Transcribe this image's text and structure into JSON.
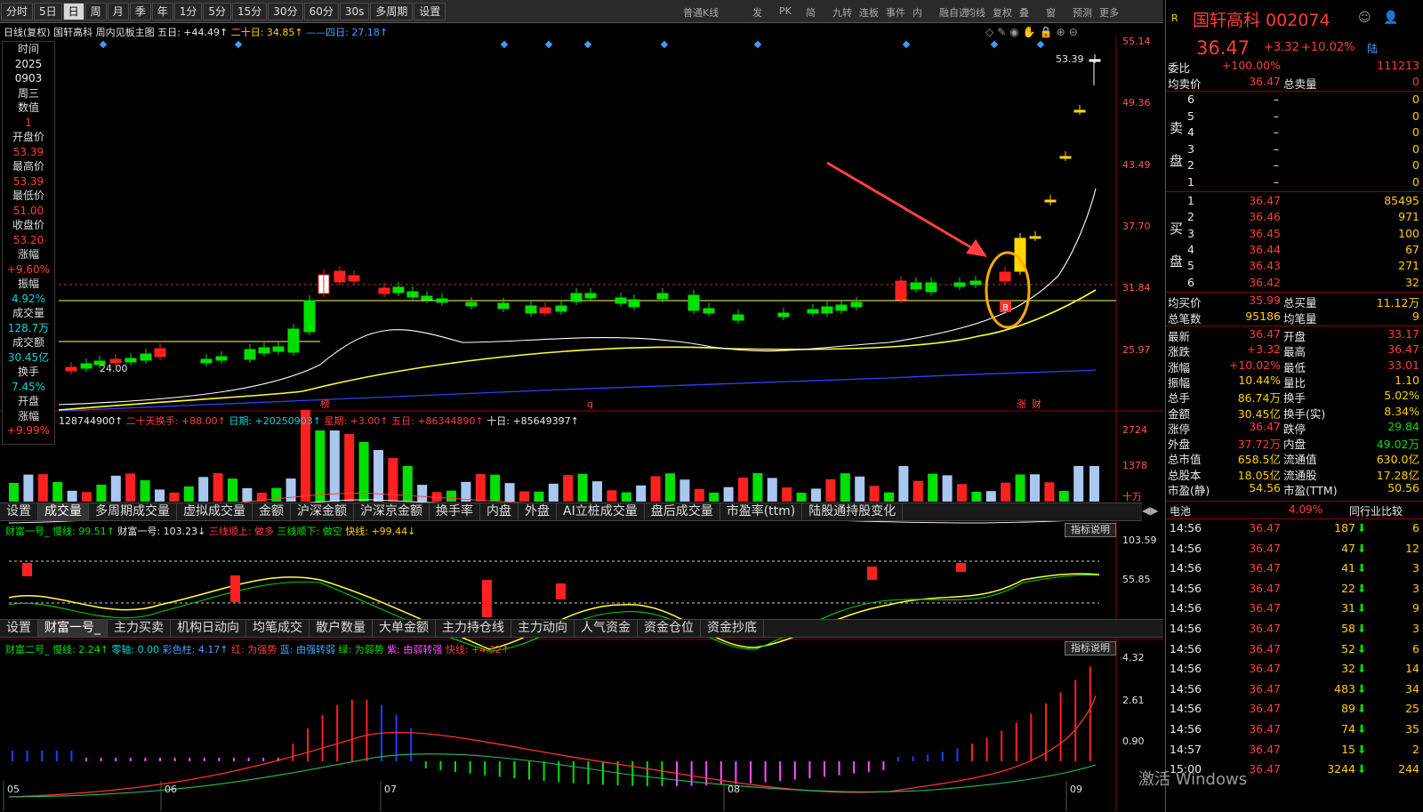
{
  "toolbar": {
    "items": [
      "分时",
      "5日",
      "日",
      "周",
      "月",
      "季",
      "年",
      "1分",
      "5分",
      "15分",
      "30分",
      "60分",
      "30s",
      "多周期",
      "设置"
    ],
    "active": "日",
    "dd": "普通K线",
    "right": [
      "发",
      "PK",
      "简",
      "九转",
      "连板",
      "事件",
      "内",
      "融自选",
      "均线",
      "复权",
      "叠",
      "窗",
      "预测",
      "更多"
    ]
  },
  "kline_info": {
    "label": "日线(复权)",
    "name": "国轩高科",
    "mode": "周内见板主图",
    "ma5": "五日: +44.49↑",
    "ma20": "二十日: 34.85↑",
    "ma40": "——四日: 27.18↑"
  },
  "left_panel": [
    [
      "时间",
      "lb"
    ],
    [
      "2025",
      "wht"
    ],
    [
      "0903",
      "wht"
    ],
    [
      "周三",
      "wht"
    ],
    [
      "数值",
      "lb"
    ],
    [
      "1",
      "red"
    ],
    [
      "开盘价",
      "lb"
    ],
    [
      "53.39",
      "red"
    ],
    [
      "最高价",
      "lb"
    ],
    [
      "53.39",
      "red"
    ],
    [
      "最低价",
      "lb"
    ],
    [
      "51.00",
      "red"
    ],
    [
      "收盘价",
      "lb"
    ],
    [
      "53.20",
      "red"
    ],
    [
      "涨幅",
      "lb"
    ],
    [
      "+9.60%",
      "red"
    ],
    [
      "振幅",
      "lb"
    ],
    [
      "4.92%",
      "cyan"
    ],
    [
      "成交量",
      "lb"
    ],
    [
      "128.7万",
      "cyan"
    ],
    [
      "成交额",
      "lb"
    ],
    [
      "30.45亿",
      "cyan"
    ],
    [
      "换手",
      "lb"
    ],
    [
      "7.45%",
      "cyan"
    ],
    [
      "开盘",
      "lb"
    ],
    [
      "涨幅",
      "lb"
    ],
    [
      "+9.99%",
      "red"
    ]
  ],
  "price_axis": [
    "55.14",
    "49.36",
    "43.49",
    "37.70",
    "31.84",
    "25.97"
  ],
  "annotations": {
    "top_price": "53.39",
    "low_price": "24.00",
    "b": "B",
    "bang": "榜",
    "q": "q",
    "zhang": "涨",
    "cai": "财"
  },
  "vol_info": {
    "v": "128744900↑",
    "twenty": "二十天换手: +88.00↑",
    "date": "日期: +20250903↑",
    "wk": "星期: +3.00↑",
    "five": "五日: +86344890↑",
    "ten": "十日: +85649397↑"
  },
  "vol_axis": [
    "2724",
    "1378",
    "十万"
  ],
  "tabs1": [
    "设置",
    "成交量",
    "多周期成交量",
    "虚拟成交量",
    "金额",
    "沪深金额",
    "沪深京金额",
    "换手率",
    "内盘",
    "外盘",
    "AI立桩成交量",
    "盘后成交量",
    "市盈率(ttm)",
    "陆股通持股变化"
  ],
  "tabs1_active": "成交量",
  "ind1": {
    "a": "财富一号_ 慢线: 99.51↑",
    "b": "财富一号: 103.23↓",
    "c": "三线顺上: 做多",
    "d": "三线顺下: 做空",
    "e": "快线: +99.44↓",
    "btn": "指标说明",
    "axis": [
      "103.59",
      "55.85"
    ]
  },
  "tabs2": [
    "设置",
    "财富一号_",
    "主力买卖",
    "机构日动向",
    "均笔成交",
    "散户数量",
    "大单金额",
    "主力持仓线",
    "主力动向",
    "人气资金",
    "资金仓位",
    "资金抄底"
  ],
  "tabs2_active": "财富一号_",
  "ind2": {
    "a": "财富二号_ 慢线: 2.24↑",
    "b": "零轴: 0.00",
    "c": "彩色柱: 4.17↑",
    "d": "红: 为强势",
    "e": "蓝: 由强转弱",
    "f": "绿: 为弱势",
    "g": "紫: 由弱转强",
    "h": "快线: +4.32↑",
    "btn": "指标说明",
    "axis": [
      "4.32",
      "2.61",
      "0.90"
    ]
  },
  "months": [
    "05",
    "06",
    "07",
    "08",
    "09"
  ],
  "right": {
    "logo": "R",
    "name": "国轩高科 002074",
    "price": "36.47",
    "chg": "+3.32",
    "pct": "+10.02%",
    "lu": "陆",
    "weibi": [
      "委比",
      "+100.00%",
      "111213"
    ],
    "avgsell": [
      "均卖价",
      "36.47",
      "总卖量",
      "0"
    ],
    "sell": [
      [
        "6",
        "",
        "–",
        "0"
      ],
      [
        "5",
        "",
        "–",
        "0"
      ],
      [
        "4",
        "",
        "–",
        "0"
      ],
      [
        "3",
        "",
        "–",
        "0"
      ],
      [
        "2",
        "",
        "–",
        "0"
      ],
      [
        "1",
        "",
        "–",
        "0"
      ]
    ],
    "buy": [
      [
        "1",
        "36.47",
        "85495"
      ],
      [
        "2",
        "36.46",
        "971"
      ],
      [
        "3",
        "36.45",
        "100"
      ],
      [
        "4",
        "36.44",
        "67"
      ],
      [
        "5",
        "36.43",
        "271"
      ],
      [
        "6",
        "36.42",
        "32"
      ]
    ],
    "mai": "卖",
    "pan": "盘",
    "buyc": "买",
    "avgbuy": [
      "均买价",
      "35.99",
      "总买量",
      "11.12万"
    ],
    "bi": [
      "总笔数",
      "95186",
      "均笔量",
      "9"
    ],
    "stats": [
      [
        "最新",
        "36.47",
        "开盘",
        "33.17"
      ],
      [
        "涨跌",
        "+3.32",
        "最高",
        "36.47"
      ],
      [
        "涨幅",
        "+10.02%",
        "最低",
        "33.01"
      ],
      [
        "振幅",
        "10.44%",
        "量比",
        "1.10"
      ],
      [
        "总手",
        "86.74万",
        "换手",
        "5.02%"
      ],
      [
        "金额",
        "30.45亿",
        "换手(实)",
        "8.34%"
      ],
      [
        "涨停",
        "36.47",
        "跌停",
        "29.84"
      ],
      [
        "外盘",
        "37.72万",
        "内盘",
        "49.02万"
      ],
      [
        "总市值",
        "658.5亿",
        "流通值",
        "630.0亿"
      ],
      [
        "总股本",
        "18.05亿",
        "流通股",
        "17.28亿"
      ],
      [
        "市盈(静)",
        "54.56",
        "市盈(TTM)",
        "50.56"
      ]
    ],
    "sector": [
      "电池",
      "4.09%",
      "同行业比较"
    ],
    "ticks": [
      [
        "14:56",
        "36.47",
        "187",
        "6"
      ],
      [
        "14:56",
        "36.47",
        "47",
        "12"
      ],
      [
        "14:56",
        "36.47",
        "41",
        "3"
      ],
      [
        "14:56",
        "36.47",
        "22",
        "3"
      ],
      [
        "14:56",
        "36.47",
        "31",
        "9"
      ],
      [
        "14:56",
        "36.47",
        "58",
        "3"
      ],
      [
        "14:56",
        "36.47",
        "52",
        "6"
      ],
      [
        "14:56",
        "36.47",
        "32",
        "14"
      ],
      [
        "14:56",
        "36.47",
        "483",
        "34"
      ],
      [
        "14:56",
        "36.47",
        "89",
        "25"
      ],
      [
        "14:56",
        "36.47",
        "74",
        "35"
      ],
      [
        "14:57",
        "36.47",
        "15",
        "2"
      ],
      [
        "15:00",
        "36.47",
        "3244",
        "244"
      ]
    ]
  },
  "watermark": "激活 Windows"
}
